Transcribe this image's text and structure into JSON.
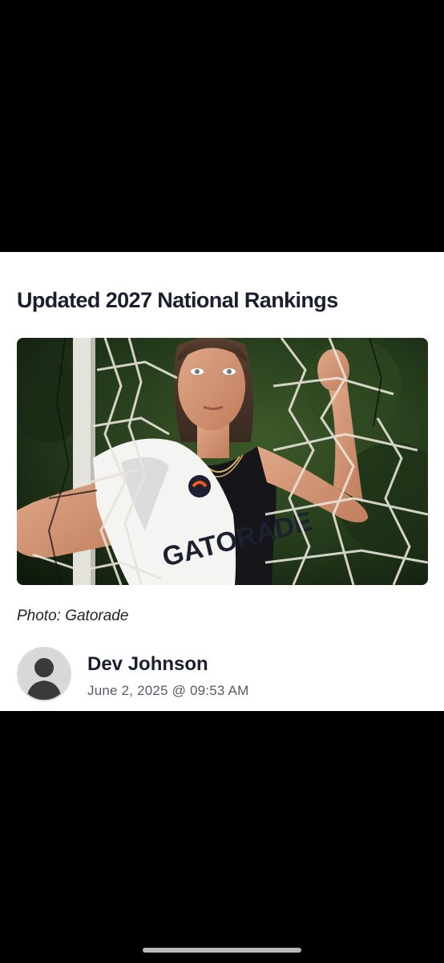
{
  "article": {
    "title": "Updated 2027 National Rankings",
    "photo": {
      "shirt_text": "GATORADE",
      "description_icon": "photo-image"
    },
    "photo_caption": "Photo: Gatorade",
    "author": {
      "name": "Dev Johnson",
      "avatar_icon": "person-silhouette-icon"
    },
    "date": "June 2, 2025 @ 09:53 AM"
  },
  "colors": {
    "background": "#000000",
    "card": "#ffffff",
    "title_text": "#1a1f2e",
    "meta_text": "#555a66",
    "home_indicator": "#b9b9b9"
  }
}
